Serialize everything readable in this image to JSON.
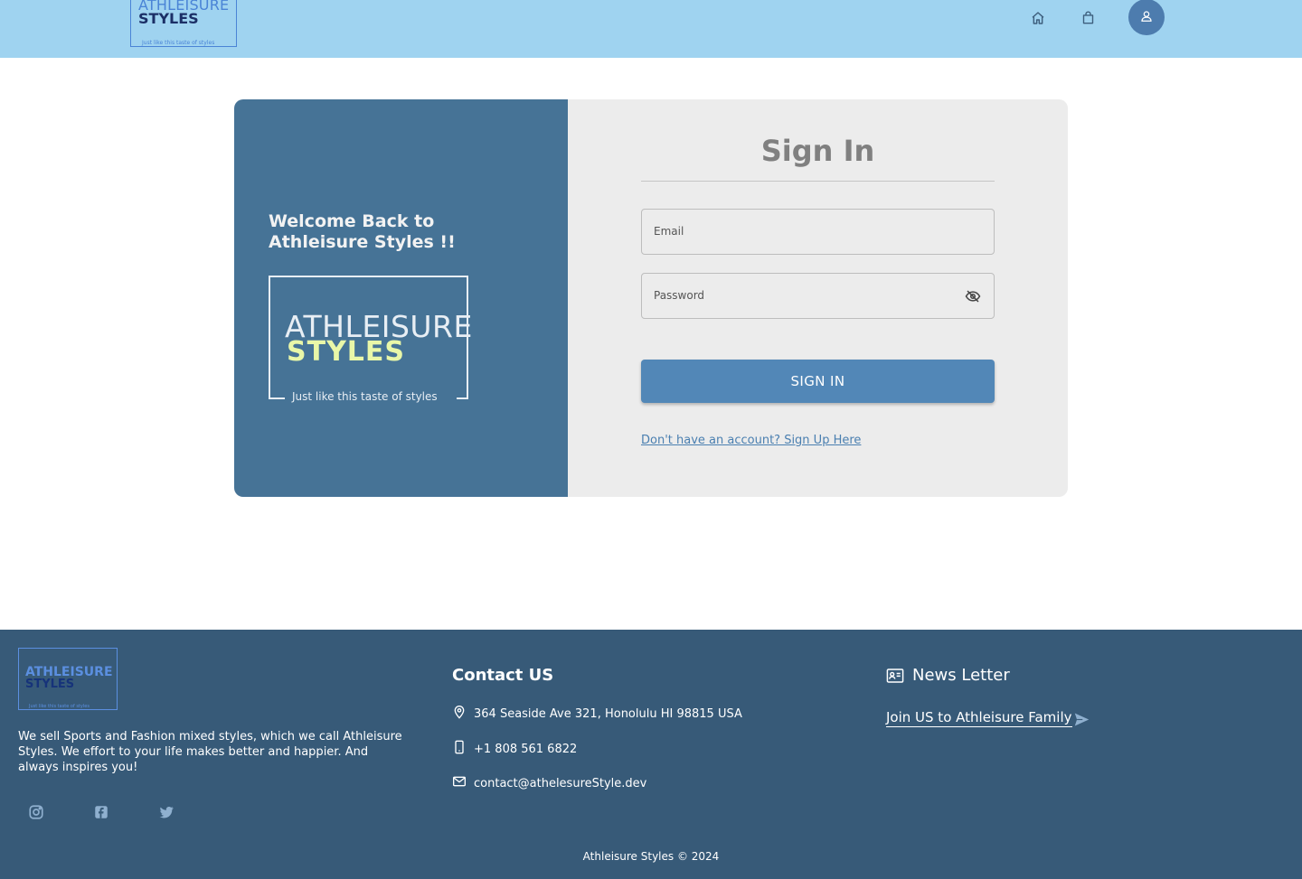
{
  "header": {
    "logo": {
      "line1": "ATHLEISURE",
      "line2": "STYLES",
      "tagline": "Just like this taste of styles"
    },
    "icons": [
      "home-icon",
      "shopping-bag-icon",
      "user-icon"
    ]
  },
  "panel": {
    "welcome": "Welcome Back to Athleisure Styles !!",
    "logo": {
      "line1": "ATHLEISURE",
      "line2": "STYLES",
      "tagline": "Just like this taste of styles"
    }
  },
  "form": {
    "title": "Sign In",
    "email_label": "Email",
    "password_label": "Password",
    "submit_label": "SIGN IN",
    "signup_link": "Don't have an account? Sign Up Here"
  },
  "footer": {
    "logo": {
      "line1": "ATHLEISURE",
      "line2": "STYLES",
      "tagline": "Just like this taste of styles"
    },
    "about": "We sell Sports and Fashion mixed styles, which we call Athleisure Styles. We effort to your life makes better and happier. And always inspires you!",
    "social_icons": [
      "instagram-icon",
      "facebook-icon",
      "twitter-icon"
    ],
    "contact": {
      "heading": "Contact US",
      "address": "364 Seaside Ave 321, Honolulu HI 98815 USA",
      "phone": "+1 808 561 6822",
      "email": "contact@athelesureStyle.dev"
    },
    "newsletter": {
      "heading": "News Letter",
      "join": "Join US to Athleisure Family"
    },
    "copyright": "Athleisure Styles © 2024"
  },
  "colors": {
    "header_bg": "#9fd3f0",
    "panel_bg": "#467396",
    "form_bg": "#ececec",
    "button_bg": "#5287b7",
    "footer_bg": "#375a78"
  }
}
